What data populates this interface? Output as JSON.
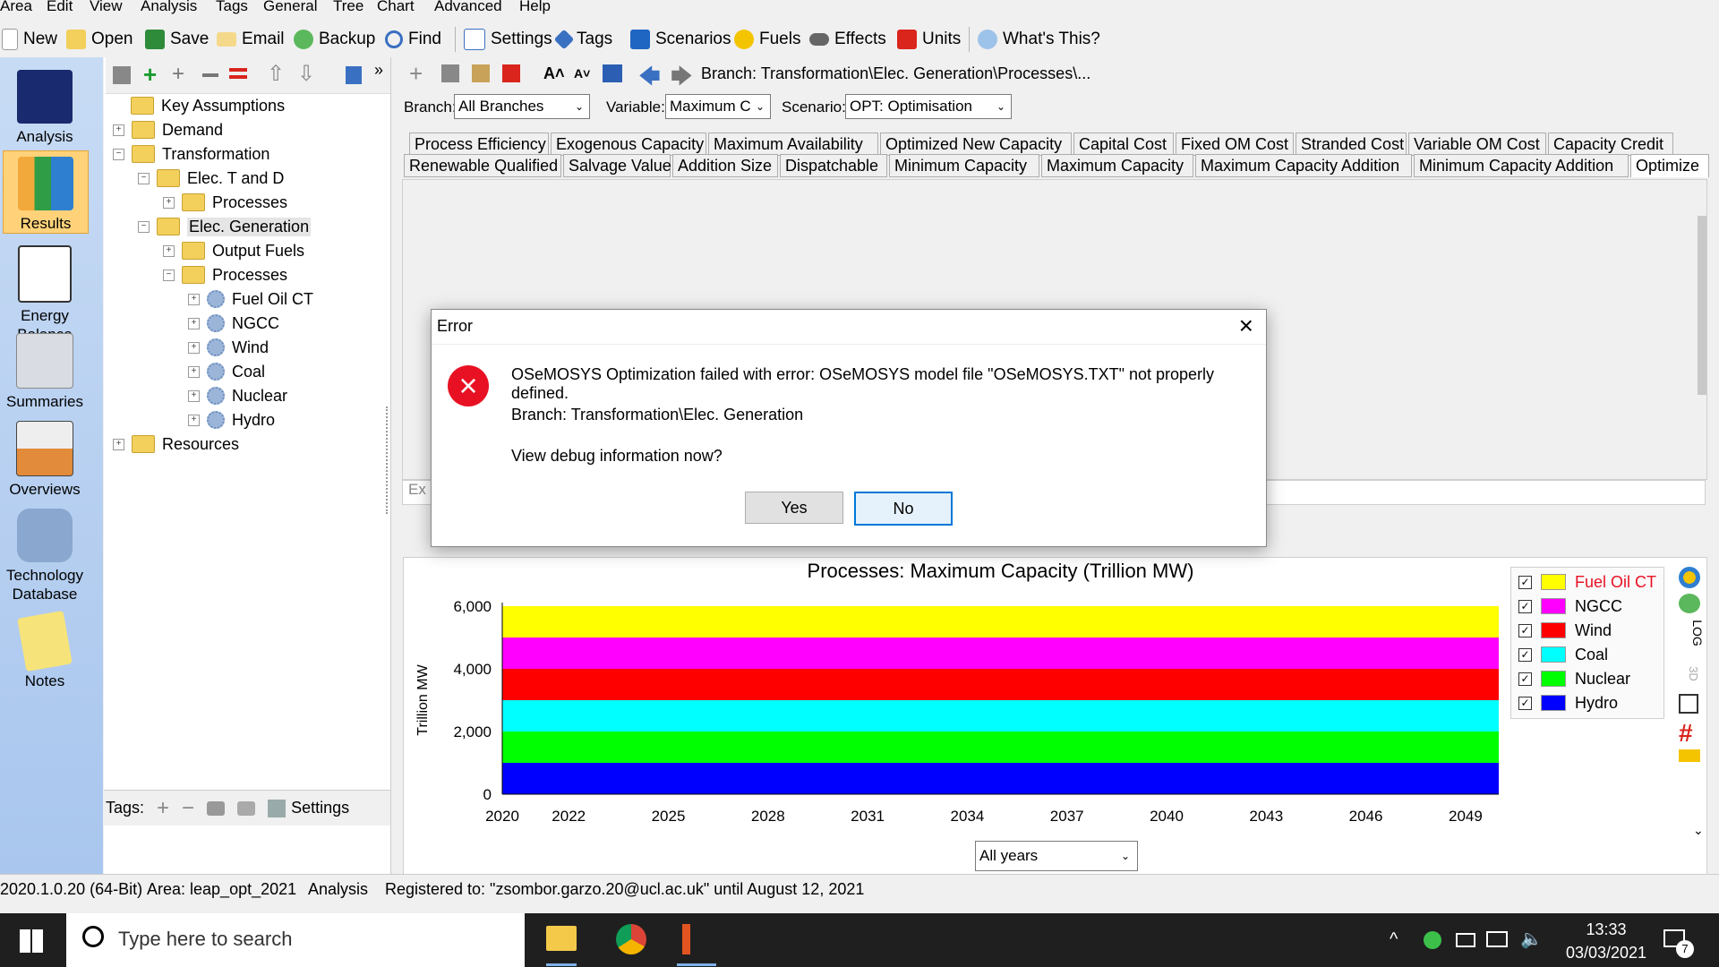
{
  "menu": [
    "Area",
    "Edit",
    "View",
    "Analysis",
    "Tags",
    "General",
    "Tree",
    "Chart",
    "Advanced",
    "Help"
  ],
  "toolbar": {
    "new": "New",
    "open": "Open",
    "save": "Save",
    "email": "Email",
    "backup": "Backup",
    "find": "Find",
    "settings": "Settings",
    "tags": "Tags",
    "scenarios": "Scenarios",
    "fuels": "Fuels",
    "effects": "Effects",
    "units": "Units",
    "whats_this": "What's This?"
  },
  "rail": [
    "Analysis",
    "Results",
    "Energy Balance",
    "Summaries",
    "Overviews",
    "Technology Database",
    "Notes"
  ],
  "tree": {
    "key_assumptions": "Key Assumptions",
    "demand": "Demand",
    "transformation": "Transformation",
    "elec_t_and_d": "Elec. T and D",
    "processes_1": "Processes",
    "elec_generation": "Elec. Generation",
    "output_fuels": "Output Fuels",
    "processes_2": "Processes",
    "plants": [
      "Fuel Oil CT",
      "NGCC",
      "Wind",
      "Coal",
      "Nuclear",
      "Hydro"
    ],
    "resources": "Resources"
  },
  "tags_bar": {
    "label": "Tags:",
    "settings": "Settings"
  },
  "breadcrumb": "Branch: Transformation\\Elec. Generation\\Processes\\...",
  "filters": {
    "branch_label": "Branch:",
    "branch_value": "All Branches",
    "variable_label": "Variable:",
    "variable_value": "Maximum C",
    "scenario_label": "Scenario:",
    "scenario_value": "OPT: Optimisation"
  },
  "tabs_row1": [
    "Process Efficiency",
    "Exogenous Capacity",
    "Maximum Availability",
    "Optimized New Capacity",
    "Capital Cost",
    "Fixed OM Cost",
    "Stranded Cost",
    "Variable OM Cost",
    "Capacity Credit"
  ],
  "tabs_row2": [
    "Renewable Qualified",
    "Salvage Value",
    "Addition Size",
    "Dispatchable",
    "Minimum Capacity",
    "Maximum Capacity",
    "Maximum Capacity Addition",
    "Minimum Capacity Addition",
    "Optimize"
  ],
  "expr_stub": "Ex",
  "dialog": {
    "title": "Error",
    "message": "OSeMOSYS Optimization failed with error: OSeMOSYS model file \"OSeMOSYS.TXT\" not properly defined.",
    "branch": "Branch: Transformation\\Elec. Generation",
    "question": "View debug information now?",
    "yes": "Yes",
    "no": "No"
  },
  "chart_data": {
    "type": "area",
    "title": "Processes: Maximum Capacity (Trillion MW)",
    "ylabel": "Trillion MW",
    "xlabel": "",
    "x_ticks": [
      "2020",
      "2022",
      "2025",
      "2028",
      "2031",
      "2034",
      "2037",
      "2040",
      "2043",
      "2046",
      "2049"
    ],
    "y_ticks": [
      "6,000",
      "4,000",
      "2,000",
      "0"
    ],
    "ylim": [
      0,
      6000
    ],
    "xlim": [
      2020,
      2050
    ],
    "stacked": true,
    "series": [
      {
        "name": "Hydro",
        "color": "#0000ff",
        "value": 1000
      },
      {
        "name": "Nuclear",
        "color": "#00ff00",
        "value": 1000
      },
      {
        "name": "Coal",
        "color": "#00ffff",
        "value": 1000
      },
      {
        "name": "Wind",
        "color": "#ff0000",
        "value": 1000
      },
      {
        "name": "NGCC",
        "color": "#ff00ff",
        "value": 1000
      },
      {
        "name": "Fuel Oil CT",
        "color": "#ffff00",
        "value": 1000
      }
    ],
    "legend": [
      "Fuel Oil CT",
      "NGCC",
      "Wind",
      "Coal",
      "Nuclear",
      "Hydro"
    ],
    "legend_placement": "right",
    "grid": false
  },
  "chart_side": {
    "log": "LOG",
    "three_d": "3D"
  },
  "years_select": "All years",
  "status": {
    "version": "2020.1.0.20 (64-Bit)",
    "area": "Area: leap_opt_2021",
    "view": "Analysis",
    "registered": "Registered to: \"zsombor.garzo.20@ucl.ac.uk\" until August 12, 2021"
  },
  "taskbar": {
    "search_placeholder": "Type here to search",
    "time": "13:33",
    "date": "03/03/2021",
    "notif_count": "7"
  }
}
